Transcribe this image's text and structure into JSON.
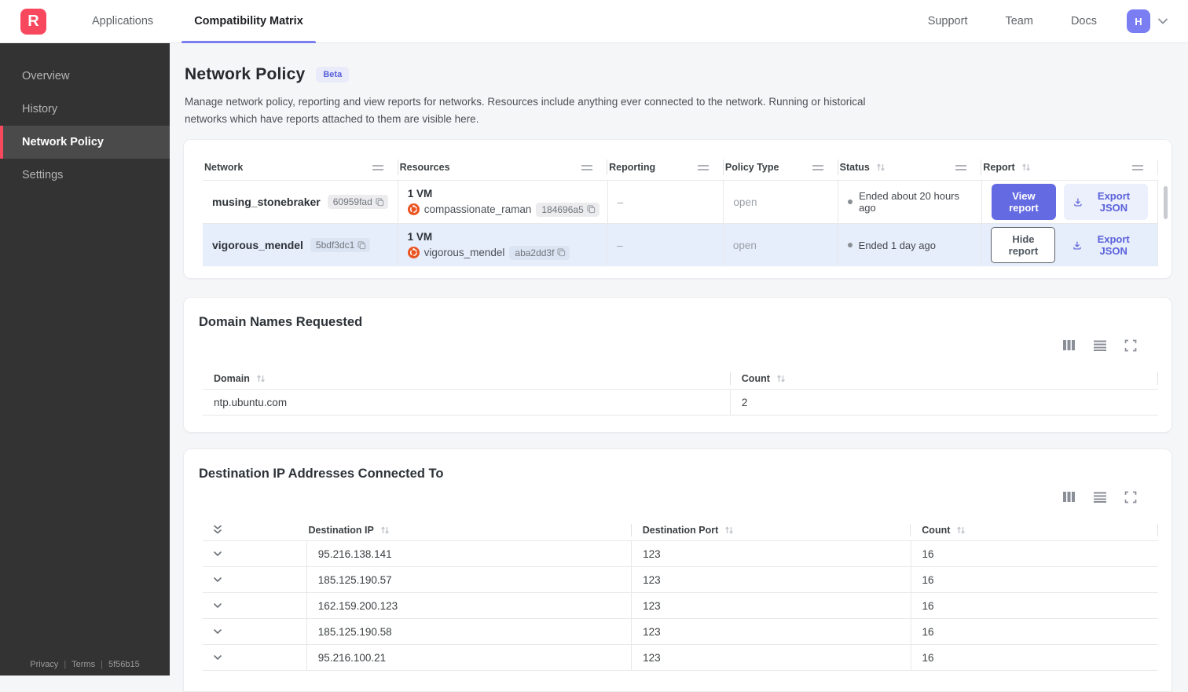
{
  "topnav": {
    "logo_letter": "R",
    "tabs": [
      {
        "label": "Applications"
      },
      {
        "label": "Compatibility Matrix"
      }
    ],
    "links": [
      {
        "label": "Support"
      },
      {
        "label": "Team"
      },
      {
        "label": "Docs"
      }
    ],
    "avatar_initial": "H"
  },
  "sidebar": {
    "items": [
      {
        "label": "Overview"
      },
      {
        "label": "History"
      },
      {
        "label": "Network Policy",
        "active": true
      },
      {
        "label": "Settings"
      }
    ],
    "footer": {
      "privacy": "Privacy",
      "terms": "Terms",
      "version": "5f56b15"
    }
  },
  "page": {
    "title": "Network Policy",
    "badge": "Beta",
    "description": "Manage network policy, reporting and view reports for networks. Resources include anything ever connected to the network. Running or historical networks which have reports attached to them are visible here."
  },
  "networks_table": {
    "columns": {
      "network": "Network",
      "resources": "Resources",
      "reporting": "Reporting",
      "policy_type": "Policy Type",
      "status": "Status",
      "report": "Report"
    },
    "rows": [
      {
        "name": "musing_stonebraker",
        "id": "60959fad",
        "resources_title": "1 VM",
        "vm_name": "compassionate_raman",
        "vm_id": "184696a5",
        "reporting": "–",
        "policy_type": "open",
        "status": "Ended about 20 hours ago",
        "report_button": "View report",
        "export_button": "Export JSON"
      },
      {
        "name": "vigorous_mendel",
        "id": "5bdf3dc1",
        "resources_title": "1 VM",
        "vm_name": "vigorous_mendel",
        "vm_id": "aba2dd3f",
        "reporting": "–",
        "policy_type": "open",
        "status": "Ended 1 day ago",
        "report_button": "Hide report",
        "export_button": "Export JSON",
        "selected": true
      }
    ]
  },
  "domains_section": {
    "title": "Domain Names Requested",
    "columns": {
      "domain": "Domain",
      "count": "Count"
    },
    "rows": [
      {
        "domain": "ntp.ubuntu.com",
        "count": "2"
      }
    ]
  },
  "destinations_section": {
    "title": "Destination IP Addresses Connected To",
    "columns": {
      "ip": "Destination IP",
      "port": "Destination Port",
      "count": "Count"
    },
    "rows": [
      {
        "ip": "95.216.138.141",
        "port": "123",
        "count": "16"
      },
      {
        "ip": "185.125.190.57",
        "port": "123",
        "count": "16"
      },
      {
        "ip": "162.159.200.123",
        "port": "123",
        "count": "16"
      },
      {
        "ip": "185.125.190.58",
        "port": "123",
        "count": "16"
      },
      {
        "ip": "95.216.100.21",
        "port": "123",
        "count": "16"
      }
    ]
  },
  "icons": {
    "copy": "overlapping-squares",
    "vm": "orange-ubuntu-circle",
    "sort": "up-down-arrows",
    "column-resize": "double-horizontal-line",
    "columns-view": "three-vertical-bars",
    "rows-view": "four-horizontal-lines",
    "fullscreen": "corner-brackets",
    "download": "arrow-into-tray",
    "expand-row": "chevron-down",
    "expand-all": "double-chevron-down",
    "user-menu": "chevron-down"
  },
  "colors": {
    "brand_red": "#f8485e",
    "accent_indigo": "#646ae2",
    "accent_indigo_light": "#eceffc",
    "tab_underline": "#7b80ee",
    "avatar_bg": "#7a7ef2",
    "beta_badge_bg": "#e9ebfa",
    "beta_badge_text": "#585fd9",
    "sidebar_bg": "#333333",
    "sidebar_active_bg": "#4a4a4a",
    "selected_row_bg": "#e7eefb",
    "page_bg": "#f5f6f8",
    "vm_icon_orange": "#e95420",
    "status_dot": "#898d94"
  }
}
